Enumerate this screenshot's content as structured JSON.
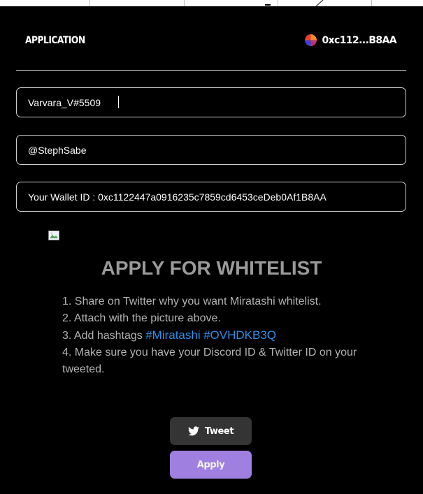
{
  "header": {
    "title": "APPLICATION",
    "wallet_short": "0xc112...B8AA"
  },
  "form": {
    "discord_value": "Varvara_V#5509",
    "twitter_value": "@StephSabe",
    "wallet_value": "Your Wallet ID : 0xc1122447a0916235c7859cd6453ceDeb0Af1B8AA"
  },
  "whitelist": {
    "title": "APPLY FOR WHITELIST",
    "step1": "1. Share on Twitter why you want Miratashi whitelist.",
    "step2": "2. Attach with the picture above.",
    "step3_prefix": "3. Add hashtags ",
    "hashtag1": "#Miratashi",
    "hashtag2": "#OVHDKB3Q",
    "step4": "4. Make sure you have your Discord ID & Twitter ID on your tweeted."
  },
  "buttons": {
    "tweet_label": "Tweet",
    "apply_label": "Apply"
  },
  "colors": {
    "background": "#000000",
    "title_gray": "#9a9a9a",
    "hashtag_blue": "#2f8ee6",
    "apply_purple": "#a887ee",
    "tweet_gray": "#343434"
  },
  "icons": {
    "wallet": "wallet-avatar-icon",
    "twitter": "twitter-bird-icon",
    "image": "broken-image-icon"
  }
}
